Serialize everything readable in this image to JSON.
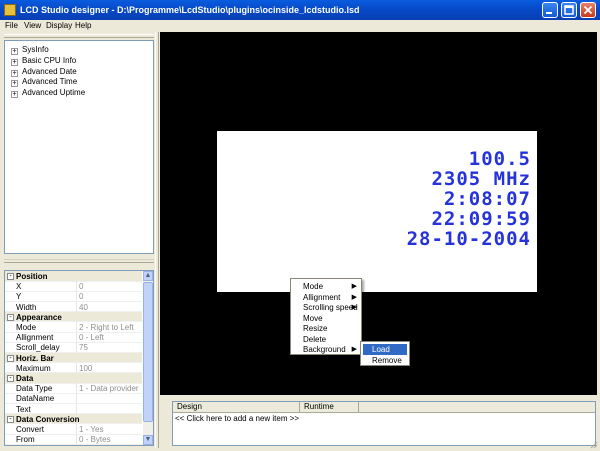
{
  "window": {
    "title": "LCD Studio designer  -  D:\\Programme\\LcdStudio\\plugins\\ocinside_lcdstudio.lsd"
  },
  "menu": [
    "File",
    "View",
    "Display",
    "Help"
  ],
  "tree": {
    "items": [
      {
        "label": "SysInfo",
        "expander": "+"
      },
      {
        "label": "Basic CPU Info",
        "expander": "+"
      },
      {
        "label": "Advanced Date",
        "expander": "+"
      },
      {
        "label": "Advanced Time",
        "expander": "+"
      },
      {
        "label": "Advanced Uptime",
        "expander": "+"
      }
    ]
  },
  "properties": {
    "rows": [
      {
        "category": true,
        "name": "Position",
        "expander": "-"
      },
      {
        "name": "X",
        "value": "0"
      },
      {
        "name": "Y",
        "value": "0"
      },
      {
        "name": "Width",
        "value": "40"
      },
      {
        "category": true,
        "name": "Appearance",
        "expander": "-"
      },
      {
        "name": "Mode",
        "value": "2 - Right to Left"
      },
      {
        "name": "Allignment",
        "value": "0 - Left"
      },
      {
        "name": "Scroll_delay",
        "value": "75"
      },
      {
        "category": true,
        "name": "Horiz. Bar",
        "expander": "-"
      },
      {
        "name": "Maximum",
        "value": "100"
      },
      {
        "category": true,
        "name": "Data",
        "expander": "-"
      },
      {
        "name": "Data Type",
        "value": "1 - Data provider"
      },
      {
        "name": "DataName",
        "value": ""
      },
      {
        "name": "Text",
        "value": ""
      },
      {
        "category": true,
        "name": "Data Conversion",
        "expander": "-"
      },
      {
        "name": "Convert",
        "value": "1 - Yes"
      },
      {
        "name": "From",
        "value": "0 - Bytes"
      }
    ]
  },
  "lcd": {
    "lines": [
      "100.5",
      "2305 MHz",
      "2:08:07",
      "22:09:59",
      "28-10-2004"
    ],
    "text_color": "#2633d9",
    "background": "#ffffff"
  },
  "context_menu": {
    "items": [
      {
        "label": "Mode",
        "submenu": true
      },
      {
        "label": "Allignment",
        "submenu": true
      },
      {
        "label": "Scrolling speed",
        "submenu": true
      },
      {
        "label": "Move",
        "submenu": false
      },
      {
        "label": "Resize",
        "submenu": false
      },
      {
        "label": "Delete",
        "submenu": false
      },
      {
        "label": "Background",
        "submenu": true
      }
    ],
    "submenu_arrow": "▶",
    "submenu": {
      "items": [
        {
          "label": "Load",
          "highlighted": true
        },
        {
          "label": "Remove",
          "highlighted": false
        }
      ]
    }
  },
  "items_grid": {
    "columns": [
      "Design",
      "Runtime"
    ],
    "add_row": "<< Click here to add a new item >>"
  },
  "colors": {
    "titlebar": "#0a5cde",
    "highlight": "#316ac5"
  }
}
